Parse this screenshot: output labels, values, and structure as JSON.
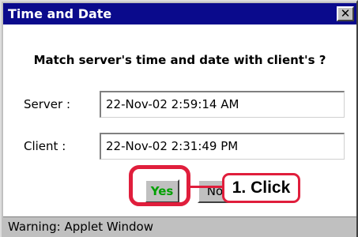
{
  "window": {
    "title": "Time and Date",
    "close_glyph": "✕"
  },
  "dialog": {
    "question": "Match server's time and date with client's ?",
    "fields": [
      {
        "label": "Server :",
        "value": "22-Nov-02 2:59:14 AM"
      },
      {
        "label": "Client :",
        "value": "22-Nov-02 2:31:49 PM"
      }
    ],
    "buttons": {
      "yes_label": "Yes",
      "no_label": "No"
    }
  },
  "annotation": {
    "callout_text": "1. Click"
  },
  "statusbar": {
    "text": "Warning: Applet Window"
  },
  "colors": {
    "titlebar": "#0a0a8c",
    "annotation_red": "#e01e3c",
    "yes_green": "#00a000",
    "window_gray": "#c0c0c0"
  }
}
